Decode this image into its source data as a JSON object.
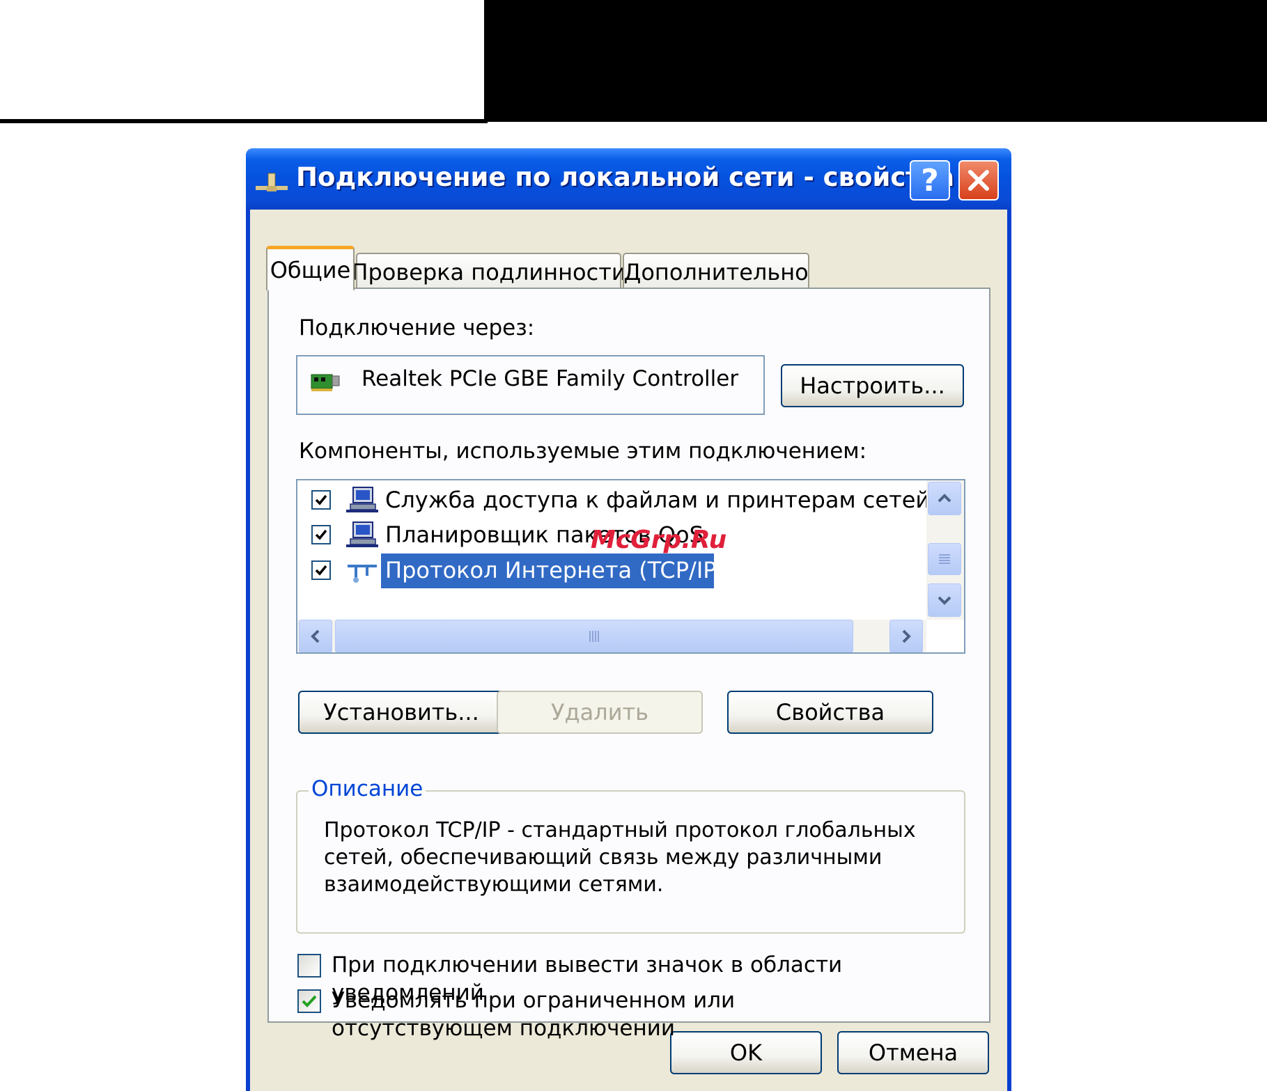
{
  "window": {
    "title": "Подключение по локальной сети - свойства",
    "help_label": "?",
    "accent": "#0551de"
  },
  "tabs": [
    {
      "label": "Общие",
      "active": true
    },
    {
      "label": "Проверка подлинности",
      "active": false
    },
    {
      "label": "Дополнительно",
      "active": false
    }
  ],
  "general": {
    "connect_using_label": "Подключение через:",
    "adapter_name": "Realtek PCIe GBE Family Controller",
    "configure_button": "Настроить...",
    "components_label": "Компоненты, используемые этим подключением:",
    "components": [
      {
        "label": "Служба доступа к файлам и принтерам сетей Micro",
        "checked": true,
        "selected": false,
        "icon": "network-service-icon"
      },
      {
        "label": "Планировщик пакетов QoS",
        "checked": true,
        "selected": false,
        "icon": "network-service-icon"
      },
      {
        "label": "Протокол Интернета (TCP/IP)",
        "checked": true,
        "selected": true,
        "icon": "protocol-icon"
      }
    ],
    "install_button": "Установить...",
    "uninstall_button": "Удалить",
    "properties_button": "Свойства",
    "description_title": "Описание",
    "description_text": "Протокол TCP/IP - стандартный протокол глобальных сетей, обеспечивающий связь между различными взаимодействующими сетями.",
    "show_icon_label": "При подключении вывести значок в области уведомлений",
    "show_icon_checked": false,
    "notify_label": "Уведомлять при ограниченном или отсутствующем подключении",
    "notify_checked": true
  },
  "footer": {
    "ok_button": "OK",
    "cancel_button": "Отмена"
  },
  "watermark": "McGrp.Ru"
}
